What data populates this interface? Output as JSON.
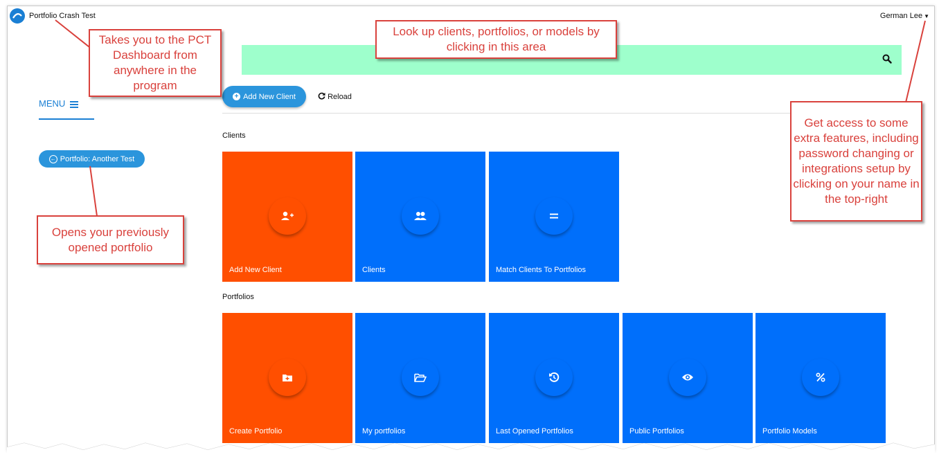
{
  "header": {
    "app_title": "Portfolio Crash Test",
    "user_name": "German Lee",
    "logo_icon": "pct-logo-icon",
    "user_menu_icon": "caret-down-icon"
  },
  "search": {
    "icon": "search-icon",
    "background_color": "#9effcc"
  },
  "toolbar": {
    "add_new_client_label": "Add New Client",
    "reload_label": "Reload",
    "add_icon": "plus-circle-icon",
    "reload_icon": "refresh-icon"
  },
  "sidebar": {
    "menu_label": "MENU",
    "previous_portfolio_label": "Portfolio: Another Test",
    "menu_icon": "hamburger-icon",
    "previous_icon": "arrow-left-circle-icon"
  },
  "sections": {
    "clients_title": "Clients",
    "portfolios_title": "Portfolios"
  },
  "clients_tiles": [
    {
      "label": "Add New Client",
      "icon": "user-plus-icon",
      "color": "#ff4f00"
    },
    {
      "label": "Clients",
      "icon": "users-icon",
      "color": "#006ffb"
    },
    {
      "label": "Match Clients To Portfolios",
      "icon": "equals-icon",
      "color": "#006ffb"
    }
  ],
  "portfolio_tiles": [
    {
      "label": "Create Portfolio",
      "icon": "folder-plus-icon",
      "color": "#ff4f00"
    },
    {
      "label": "My portfolios",
      "icon": "folder-open-icon",
      "color": "#006ffb"
    },
    {
      "label": "Last Opened Portfolios",
      "icon": "history-icon",
      "color": "#006ffb"
    },
    {
      "label": "Public Portfolios",
      "icon": "eye-icon",
      "color": "#006ffb"
    },
    {
      "label": "Portfolio Models",
      "icon": "percent-icon",
      "color": "#006ffb"
    }
  ],
  "callouts": {
    "dashboard": "Takes you to the PCT Dashboard from anywhere in the program",
    "lookup": "Look up clients, portfolios, or models by clicking in this area",
    "account": "Get access to some extra features, including password changing or integrations setup by clicking on your name in the top-right",
    "previous": "Opens your previously opened portfolio"
  },
  "colors": {
    "accent": "#2b95dc",
    "brand_blue": "#1a7fd4",
    "tile_orange": "#ff4f00",
    "tile_blue": "#006ffb",
    "callout_red": "#d9413c"
  }
}
